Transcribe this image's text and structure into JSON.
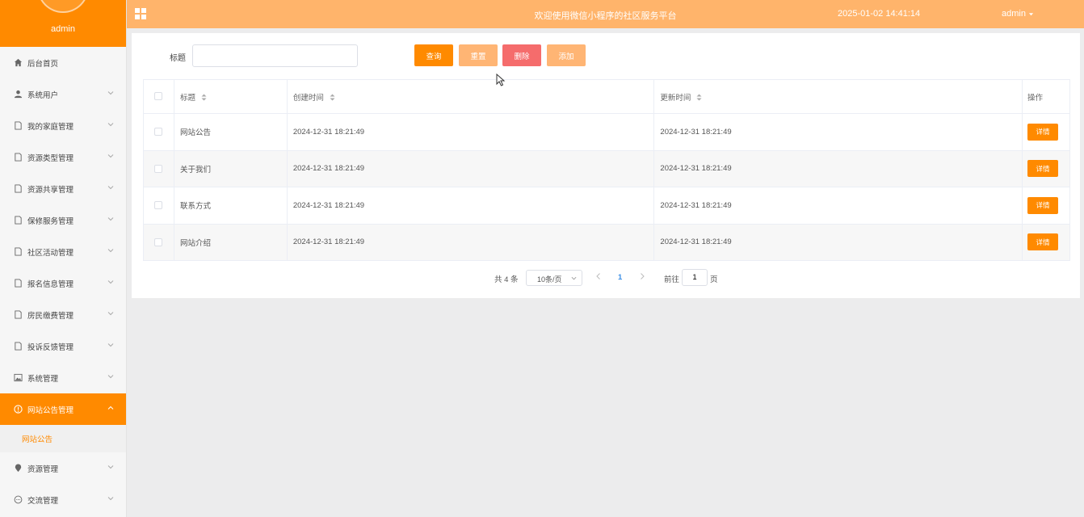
{
  "sidebar": {
    "username": "admin",
    "items": [
      {
        "label": "后台首页",
        "icon": "home-icon"
      },
      {
        "label": "系统用户",
        "icon": "user-icon"
      },
      {
        "label": "我的家庭管理",
        "icon": "document-icon"
      },
      {
        "label": "资源类型管理",
        "icon": "document-icon"
      },
      {
        "label": "资源共享管理",
        "icon": "document-icon"
      },
      {
        "label": "保修服务管理",
        "icon": "document-icon"
      },
      {
        "label": "社区活动管理",
        "icon": "document-icon"
      },
      {
        "label": "报名信息管理",
        "icon": "document-icon"
      },
      {
        "label": "房民缴费管理",
        "icon": "document-icon"
      },
      {
        "label": "投诉反馈管理",
        "icon": "document-icon"
      },
      {
        "label": "系统管理",
        "icon": "picture-icon"
      },
      {
        "label": "网站公告管理",
        "icon": "info-circle-icon",
        "active": true
      },
      {
        "label": "资源管理",
        "icon": "location-icon"
      },
      {
        "label": "交流管理",
        "icon": "chat-icon"
      }
    ],
    "submenu": {
      "label": "网站公告"
    }
  },
  "header": {
    "welcome": "欢迎使用微信小程序的社区服务平台",
    "datetime": "2025-01-02 14:41:14",
    "user": "admin"
  },
  "search": {
    "label": "标题",
    "placeholder": "",
    "value": ""
  },
  "buttons": {
    "query": "查询",
    "reset": "重置",
    "delete": "删除",
    "add": "添加"
  },
  "table": {
    "headers": {
      "title": "标题",
      "created": "创建时间",
      "updated": "更新时间",
      "ops": "操作"
    },
    "rows": [
      {
        "title": "网站公告",
        "created": "2024-12-31 18:21:49",
        "updated": "2024-12-31 18:21:49",
        "action": "详情"
      },
      {
        "title": "关于我们",
        "created": "2024-12-31 18:21:49",
        "updated": "2024-12-31 18:21:49",
        "action": "详情"
      },
      {
        "title": "联系方式",
        "created": "2024-12-31 18:21:49",
        "updated": "2024-12-31 18:21:49",
        "action": "详情"
      },
      {
        "title": "网站介绍",
        "created": "2024-12-31 18:21:49",
        "updated": "2024-12-31 18:21:49",
        "action": "详情"
      }
    ]
  },
  "pagination": {
    "total": "共 4 条",
    "page_size": "10条/页",
    "current_page": "1",
    "goto_label": "前往",
    "goto_value": "1",
    "unit": "页"
  },
  "colors": {
    "primary": "#ff8a00",
    "header_bg": "#ffb46b",
    "light": "#ffb574",
    "danger": "#f56c6c"
  }
}
